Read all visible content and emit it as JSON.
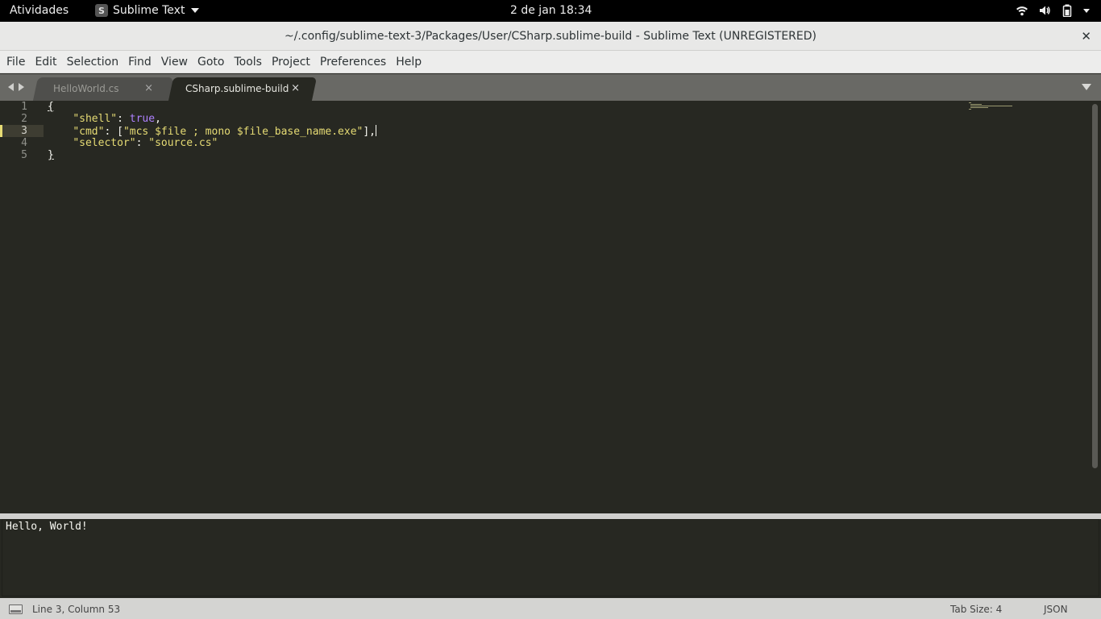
{
  "system_bar": {
    "activities": "Atividades",
    "app_name": "Sublime Text",
    "clock": "2 de jan  18:34"
  },
  "window": {
    "title": "~/.config/sublime-text-3/Packages/User/CSharp.sublime-build - Sublime Text (UNREGISTERED)",
    "close": "✕"
  },
  "menu": [
    "File",
    "Edit",
    "Selection",
    "Find",
    "View",
    "Goto",
    "Tools",
    "Project",
    "Preferences",
    "Help"
  ],
  "tabs": [
    {
      "label": "HelloWorld.cs",
      "close": "×",
      "active": false
    },
    {
      "label": "CSharp.sublime-build",
      "close": "×",
      "active": true
    }
  ],
  "editor": {
    "line_numbers": [
      "1",
      "2",
      "3",
      "4",
      "5"
    ],
    "current_line": 3,
    "lines": {
      "l1_open": "{",
      "l2_key": "\"shell\"",
      "l2_sep": ": ",
      "l2_val": "true",
      "l2_end": ",",
      "l3_key": "\"cmd\"",
      "l3_sep": ": [",
      "l3_val": "\"mcs $file ; mono $file_base_name.exe\"",
      "l3_end": "],",
      "l4_key": "\"selector\"",
      "l4_sep": ": ",
      "l4_val": "\"source.cs\"",
      "l5_close": "}"
    },
    "indent": "    ",
    "colors": {
      "background": "#272822",
      "string": "#e6db74",
      "constant": "#ae81ff",
      "text": "#f8f8f2"
    }
  },
  "output": {
    "text": "Hello, World!"
  },
  "status": {
    "position": "Line 3, Column 53",
    "tab_size": "Tab Size: 4",
    "syntax": "JSON"
  }
}
